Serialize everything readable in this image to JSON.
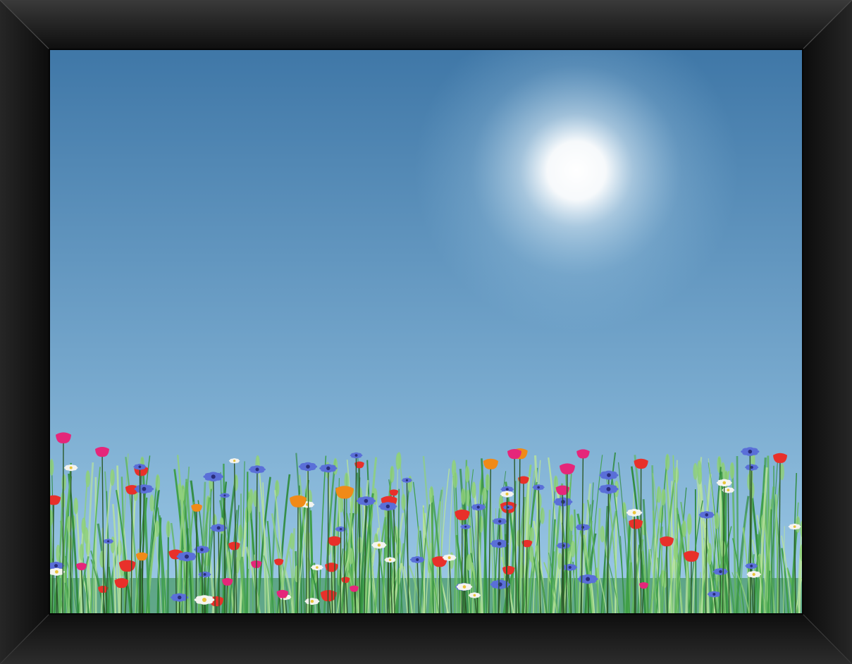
{
  "artwork": {
    "subject": "",
    "frame_color": "#141414",
    "frame_highlight": "#3a3a3a",
    "sky_top": "#3f77a7",
    "sky_bottom": "#9ecbe8",
    "sun_color": "#ffffff",
    "grass_colors": [
      "#2f8a3c",
      "#5fb55a",
      "#8fd07a",
      "#b7e39c",
      "#3e9e47"
    ],
    "flower_colors": {
      "poppy": "#e8302a",
      "pink": "#e5267a",
      "orange": "#f08a18",
      "blue": "#5a6fd8",
      "white": "#f4f4f0"
    }
  }
}
